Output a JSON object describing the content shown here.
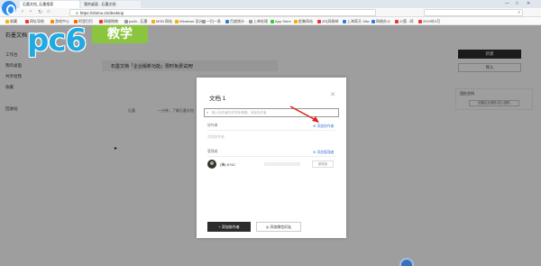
{
  "browser": {
    "tabs": [
      {
        "label": "石墨文档_石墨搜索",
        "active": true
      },
      {
        "label": "我的桌面 - 石墨文档",
        "active": false
      }
    ],
    "url": "https://shimo.im/desktop",
    "bookmarks": [
      "收藏",
      "网址导航",
      "游戏中心",
      "阿里巴巴",
      "网络购物",
      "pa4h - 石墨",
      "MSN 网站",
      "Windows 设计",
      "一扫一条",
      "百度统计 -",
      "上单处理",
      "App Store",
      "赶集网站",
      "2R(网易邮",
      "上海家天 18w",
      "网络办公",
      "火狐 - 网",
      "2019年2月"
    ]
  },
  "page": {
    "title": "石墨文档",
    "sidebar": [
      "工作台",
      "我的桌面",
      "共享给我",
      "收藏",
      "回收站"
    ],
    "banner": "石墨文档「企业版新功能」限时免费试用!",
    "cells": [
      "石墨",
      "一分钟，了解石墨文档"
    ],
    "new_button": "新建",
    "import_button": "导入",
    "right_card_title": "团队空间",
    "right_card_button": "创建企业团队/加入团队"
  },
  "modal": {
    "title": "文档 1",
    "search_placeholder": "输入协作者的手机号/邮箱，添加协作者",
    "collaborators_label": "协作者",
    "add_collab_link": "添加协作者",
    "empty_hint": "添加协作者",
    "managers_label": "管理者",
    "add_manager_link": "添加管理者",
    "owner_name": "(锋) 6742",
    "owner_role": "管理者",
    "btn_add_collab": "添加协作者",
    "btn_add_wechat": "添加微信好友"
  },
  "watermark": {
    "logo": "pc6",
    "badge": "教学"
  }
}
